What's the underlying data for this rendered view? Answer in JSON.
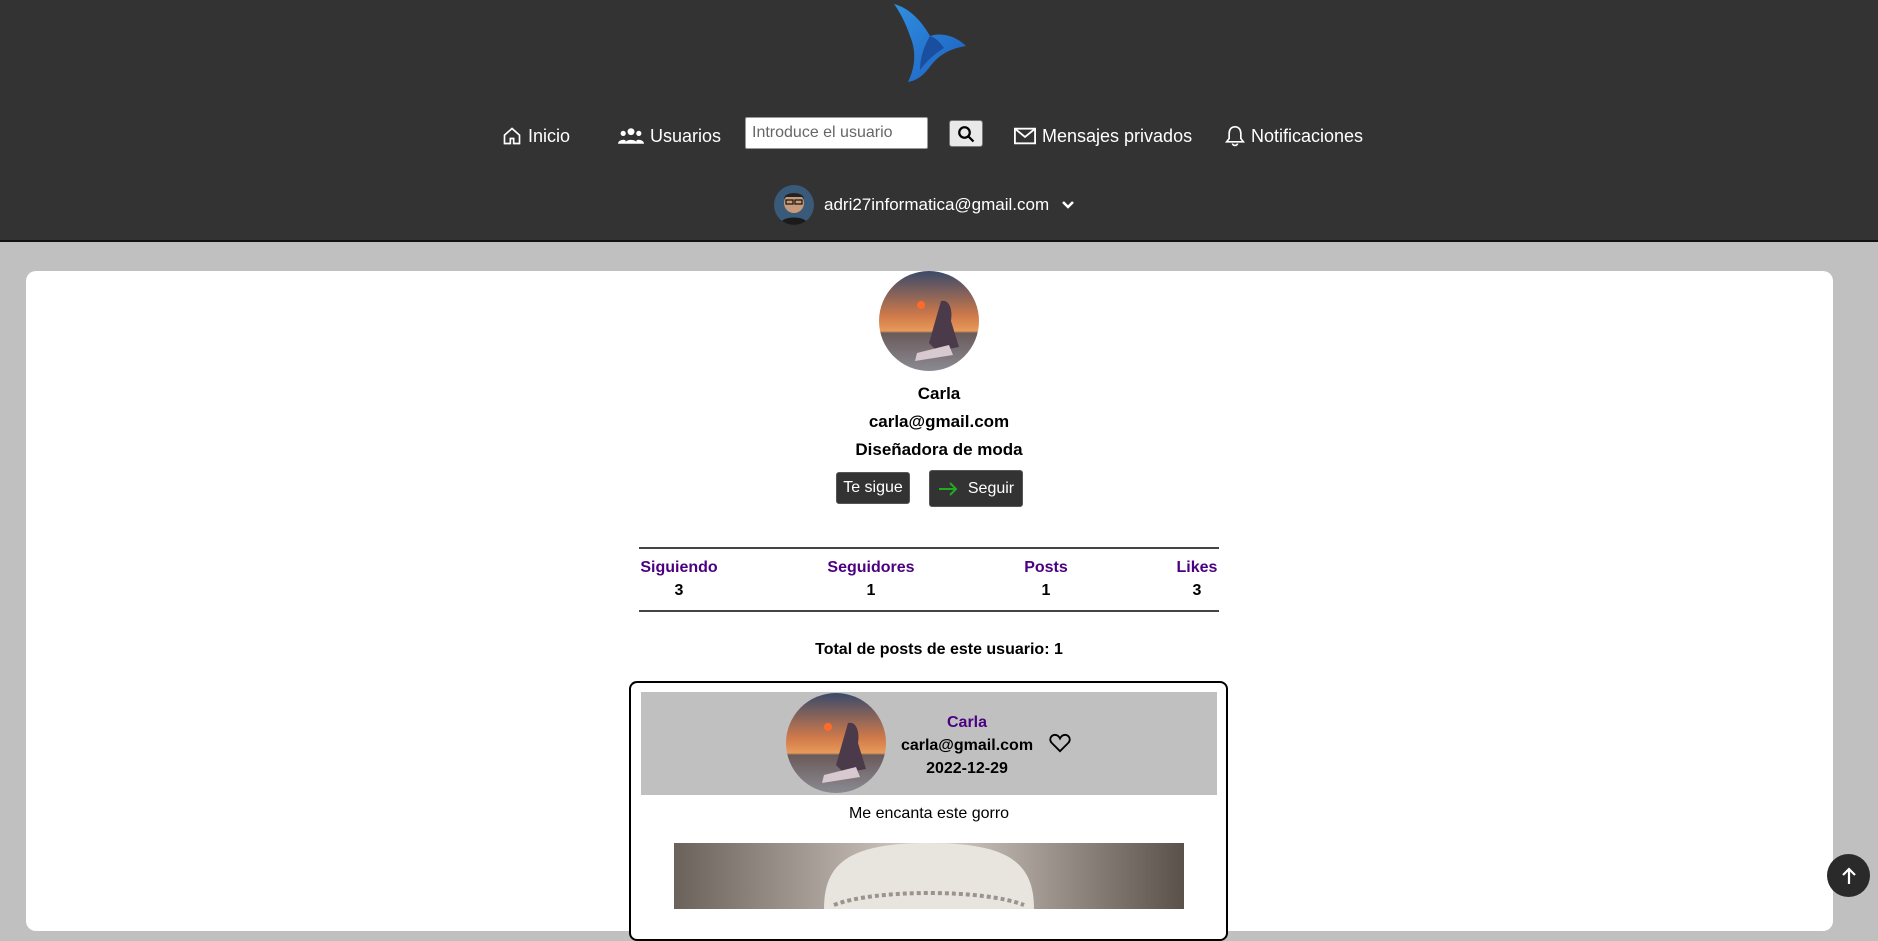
{
  "header": {
    "nav": {
      "home_label": "Inicio",
      "users_label": "Usuarios",
      "messages_label": "Mensajes privados",
      "notifications_label": "Notificaciones"
    },
    "search": {
      "placeholder": "Introduce el usuario",
      "value": ""
    },
    "account": {
      "email": "adri27informatica@gmail.com"
    }
  },
  "profile": {
    "name": "Carla",
    "email": "carla@gmail.com",
    "bio": "Diseñadora de moda",
    "follows_you_label": "Te sigue",
    "follow_label": "Seguir",
    "stats": [
      {
        "label": "Siguiendo",
        "value": "3"
      },
      {
        "label": "Seguidores",
        "value": "1"
      },
      {
        "label": "Posts",
        "value": "1"
      },
      {
        "label": "Likes",
        "value": "3"
      }
    ],
    "total_posts_text": "Total de posts de este usuario: 1"
  },
  "post": {
    "author": "Carla",
    "email": "carla@gmail.com",
    "date": "2022-12-29",
    "text": "Me encanta este gorro"
  },
  "colors": {
    "topbar": "#333333",
    "page_bg": "#c0c0c0",
    "link_purple": "#4b0082",
    "follow_arrow": "#22aa22"
  }
}
